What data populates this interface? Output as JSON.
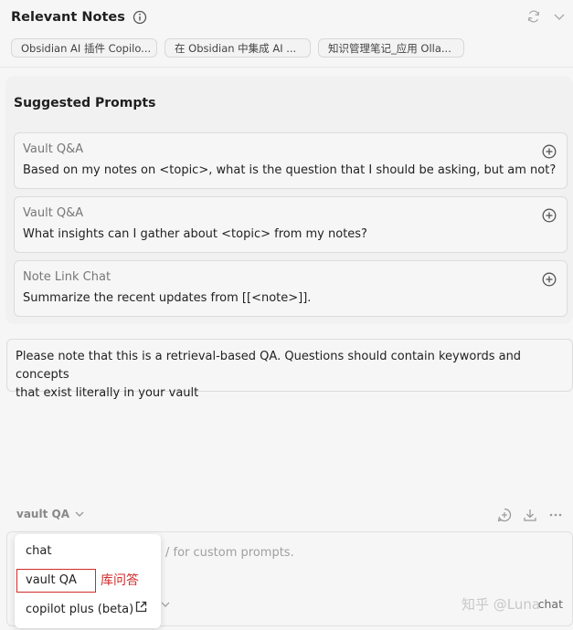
{
  "header": {
    "title": "Relevant Notes",
    "icons": {
      "info": "info-icon",
      "refresh": "refresh-icon",
      "collapse": "chevron-down-icon"
    }
  },
  "relevant_notes": [
    {
      "label": "Obsidian AI 插件 Copilo..."
    },
    {
      "label": "在 Obsidian 中集成 AI ..."
    },
    {
      "label": "知识管理笔记_应用 Olla..."
    }
  ],
  "suggested_prompts": {
    "title": "Suggested Prompts",
    "items": [
      {
        "type": "Vault Q&A",
        "text": "Based on my notes on <topic>, what is the question that I should be asking, but am not?"
      },
      {
        "type": "Vault Q&A",
        "text": "What insights can I gather about <topic> from my notes?"
      },
      {
        "type": "Note Link Chat",
        "text": "Summarize the recent updates from [[<note>]]."
      }
    ]
  },
  "notice": {
    "line1": "Please note that this is a retrieval-based QA. Questions should contain keywords and concepts",
    "line2": "that exist literally in your vault"
  },
  "toolbar": {
    "mode_label": "vault QA",
    "icons": [
      "new-chat-icon",
      "save-icon",
      "more-icon"
    ]
  },
  "input": {
    "placeholder_fragment": "/ for custom prompts.",
    "send_label": "chat"
  },
  "mode_dropdown": {
    "options": [
      {
        "label": "chat"
      },
      {
        "label": "vault QA",
        "selected": true
      },
      {
        "label": "copilot plus (beta)",
        "icon": "external-link-icon"
      }
    ],
    "annotation": "库问答"
  },
  "watermark": "知乎 @Luna",
  "colors": {
    "accent_red": "#d12a2a",
    "background": "#f6f6f6"
  }
}
